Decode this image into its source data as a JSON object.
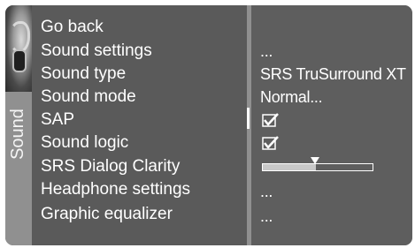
{
  "panel": {
    "side_tab_label": "Sound",
    "menu_items": [
      {
        "label": "Go back"
      },
      {
        "label": "Sound settings"
      },
      {
        "label": "Sound type"
      },
      {
        "label": "Sound mode"
      },
      {
        "label": "SAP"
      },
      {
        "label": "Sound logic"
      },
      {
        "label": "SRS Dialog Clarity"
      },
      {
        "label": "Headphone settings"
      },
      {
        "label": "Graphic equalizer"
      }
    ],
    "values": {
      "sound_settings": "...",
      "sound_type": "SRS TruSurround XT",
      "sound_mode": "Normal...",
      "sap_checked": true,
      "sound_logic_checked": true,
      "srs_dialog_clarity_level": 0.48,
      "headphone_settings": "...",
      "graphic_equalizer": "..."
    }
  },
  "colors": {
    "frame": "#6a6a6a",
    "side_tab": "#909090",
    "text": "#ffffff"
  }
}
